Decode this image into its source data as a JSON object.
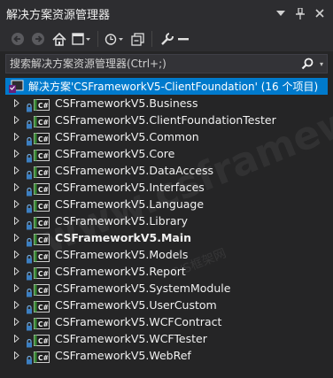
{
  "window": {
    "title": "解决方案资源管理器",
    "buttons": [
      "chevron-down-icon",
      "pin-icon",
      "close-icon"
    ]
  },
  "toolbar": {
    "items": [
      "back-icon",
      "forward-icon",
      "home-icon",
      "switch-views-icon",
      "pending-changes-icon",
      "sync-icon",
      "collapse-all-icon",
      "properties-icon",
      "preview-icon"
    ]
  },
  "search": {
    "placeholder": "搜索解决方案资源管理器(Ctrl+;)"
  },
  "solution": {
    "label": "解决方案'CSFrameworkV5-ClientFoundation' (16 个项目)"
  },
  "projects": [
    {
      "label": "CSFrameworkV5.Business",
      "bold": false
    },
    {
      "label": "CSFrameworkV5.ClientFoundationTester",
      "bold": false
    },
    {
      "label": "CSFrameworkV5.Common",
      "bold": false
    },
    {
      "label": "CSFrameworkV5.Core",
      "bold": false
    },
    {
      "label": "CSFrameworkV5.DataAccess",
      "bold": false
    },
    {
      "label": "CSFrameworkV5.Interfaces",
      "bold": false
    },
    {
      "label": "CSFrameworkV5.Language",
      "bold": false
    },
    {
      "label": "CSFrameworkV5.Library",
      "bold": false
    },
    {
      "label": "CSFrameworkV5.Main",
      "bold": true
    },
    {
      "label": "CSFrameworkV5.Models",
      "bold": false
    },
    {
      "label": "CSFrameworkV5.Report",
      "bold": false
    },
    {
      "label": "CSFrameworkV5.SystemModule",
      "bold": false
    },
    {
      "label": "CSFrameworkV5.UserCustom",
      "bold": false
    },
    {
      "label": "CSFrameworkV5.WCFContract",
      "bold": false
    },
    {
      "label": "CSFrameworkV5.WCFTester",
      "bold": false
    },
    {
      "label": "CSFrameworkV5.WebRef",
      "bold": false
    }
  ],
  "watermark": {
    "main": "www.csframework",
    "sub": "C/S框架网"
  },
  "colors": {
    "background": "#252526",
    "selection": "#007acc",
    "text": "#f1f1f1",
    "csharp_icon": "#368832"
  }
}
